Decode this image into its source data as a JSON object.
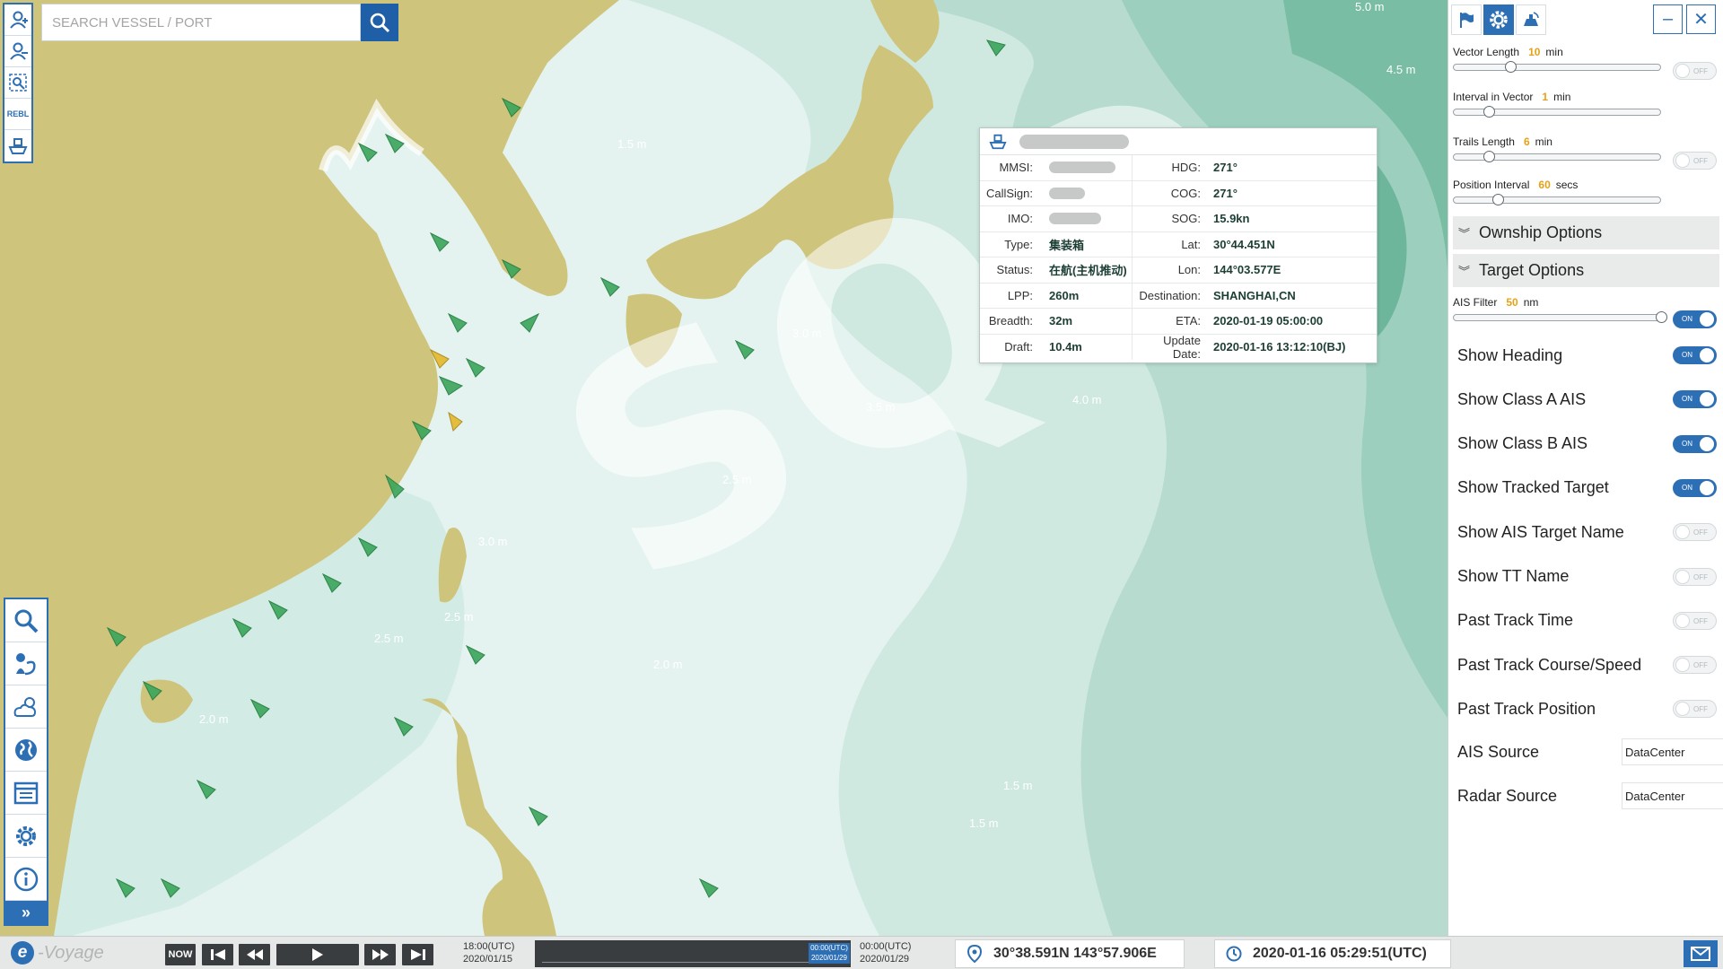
{
  "search": {
    "placeholder": "SEARCH VESSEL / PORT"
  },
  "left_tools": {
    "top": [
      {
        "name": "add-user-icon"
      },
      {
        "name": "remove-user-icon"
      },
      {
        "name": "area-search-icon"
      },
      {
        "name": "rebl-tool",
        "label": "REBL"
      },
      {
        "name": "ship-icon"
      }
    ],
    "bottom": [
      {
        "name": "search-icon"
      },
      {
        "name": "route-icon"
      },
      {
        "name": "weather-icon"
      },
      {
        "name": "globe-icon"
      },
      {
        "name": "layout-icon"
      },
      {
        "name": "settings-icon"
      },
      {
        "name": "info-icon"
      },
      {
        "name": "expand-icon",
        "label": "»"
      }
    ]
  },
  "map": {
    "watermark": "SQD",
    "depth_labels": [
      "5.0 m",
      "4.5 m",
      "1.5 m",
      "3.0 m",
      "3.5 m",
      "4.0 m",
      "2.5 m",
      "3.0 m",
      "2.5 m",
      "2.5 m",
      "2.0 m",
      "2.0 m",
      "1.5 m",
      "1.5 m"
    ]
  },
  "popup": {
    "rows": [
      {
        "l1": "MMSI:",
        "v1": "",
        "l2": "HDG:",
        "v2": "271°"
      },
      {
        "l1": "CallSign:",
        "v1": "",
        "l2": "COG:",
        "v2": "271°"
      },
      {
        "l1": "IMO:",
        "v1": "",
        "l2": "SOG:",
        "v2": "15.9kn"
      },
      {
        "l1": "Type:",
        "v1": "集装箱",
        "l2": "Lat:",
        "v2": "30°44.451N"
      },
      {
        "l1": "Status:",
        "v1": "在航(主机推动)",
        "l2": "Lon:",
        "v2": "144°03.577E"
      },
      {
        "l1": "LPP:",
        "v1": "260m",
        "l2": "Destination:",
        "v2": "SHANGHAI,CN"
      },
      {
        "l1": "Breadth:",
        "v1": "32m",
        "l2": "ETA:",
        "v2": "2020-01-19 05:00:00"
      },
      {
        "l1": "Draft:",
        "v1": "10.4m",
        "l2": "Update Date:",
        "v2": "2020-01-16 13:12:10(BJ)"
      }
    ]
  },
  "panel": {
    "tabs": [
      {
        "name": "flag-icon"
      },
      {
        "name": "gear-icon",
        "active": true
      },
      {
        "name": "radar-icon"
      }
    ],
    "window_buttons": {
      "minimize": "–",
      "close": "✕"
    },
    "sliders": [
      {
        "label": "Vector Length",
        "value": "10",
        "unit": "min",
        "position": 0.27,
        "has_toggle": true,
        "toggle": "OFF"
      },
      {
        "label": "Interval in Vector",
        "value": "1",
        "unit": "min",
        "position": 0.17,
        "has_toggle": false
      },
      {
        "label": "Trails Length",
        "value": "6",
        "unit": "min",
        "position": 0.17,
        "has_toggle": true,
        "toggle": "OFF"
      },
      {
        "label": "Position Interval",
        "value": "60",
        "unit": "secs",
        "position": 0.21,
        "has_toggle": false
      }
    ],
    "sections": {
      "ownship": "Ownship Options",
      "target": "Target Options"
    },
    "ais_filter": {
      "label": "AIS Filter",
      "value": "50",
      "unit": "nm",
      "position": 1.0,
      "toggle": "ON"
    },
    "options": [
      {
        "label": "Show Heading",
        "state": "ON"
      },
      {
        "label": "Show Class A AIS",
        "state": "ON"
      },
      {
        "label": "Show Class B AIS",
        "state": "ON"
      },
      {
        "label": "Show Tracked Target",
        "state": "ON"
      },
      {
        "label": "Show AIS Target Name",
        "state": "OFF"
      },
      {
        "label": "Show TT Name",
        "state": "OFF"
      },
      {
        "label": "Past Track Time",
        "state": "OFF"
      },
      {
        "label": "Past Track Course/Speed",
        "state": "OFF"
      },
      {
        "label": "Past Track Position",
        "state": "OFF"
      }
    ],
    "sources": [
      {
        "label": "AIS Source",
        "value": "DataCenter"
      },
      {
        "label": "Radar Source",
        "value": "DataCenter"
      }
    ]
  },
  "bottombar": {
    "brand": "-Voyage",
    "brand_letter": "e",
    "now_label": "NOW",
    "start": {
      "time": "18:00(UTC)",
      "date": "2020/01/15"
    },
    "marker": {
      "time": "00:00(UTC)",
      "date": "2020/01/29"
    },
    "end": {
      "time": "00:00(UTC)",
      "date": "2020/01/29"
    },
    "position": "30°38.591N 143°57.906E",
    "clock": "2020-01-16 05:29:51(UTC)"
  }
}
